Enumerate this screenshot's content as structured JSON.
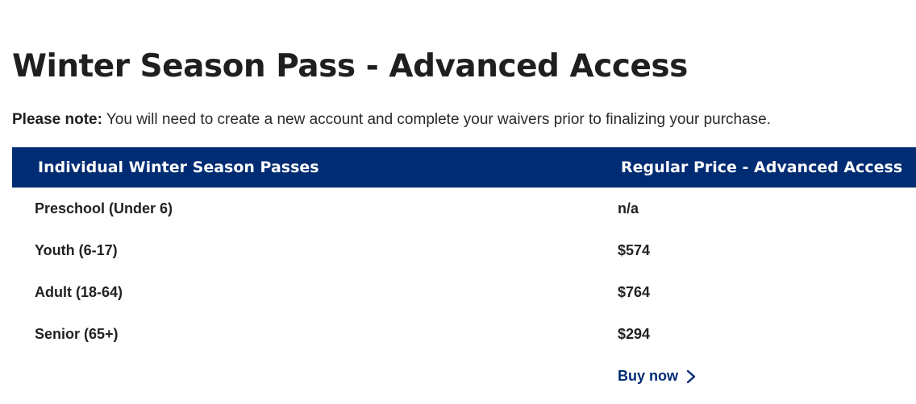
{
  "title": "Winter Season Pass - Advanced Access",
  "note": {
    "label": "Please note:",
    "text": " You will need to create a new account and complete your waivers prior to finalizing your purchase."
  },
  "table": {
    "headers": [
      "Individual Winter Season Passes",
      "Regular Price - Advanced Access"
    ],
    "rows": [
      {
        "pass": "Preschool (Under 6)",
        "price": "n/a"
      },
      {
        "pass": "Youth (6-17)",
        "price": "$574"
      },
      {
        "pass": "Adult (18-64)",
        "price": "$764"
      },
      {
        "pass": "Senior (65+)",
        "price": "$294"
      }
    ]
  },
  "cta": {
    "label": "Buy now",
    "icon": "chevron-right-icon"
  },
  "colors": {
    "header_bg": "#002c73",
    "link": "#002c73",
    "text": "#222222"
  }
}
